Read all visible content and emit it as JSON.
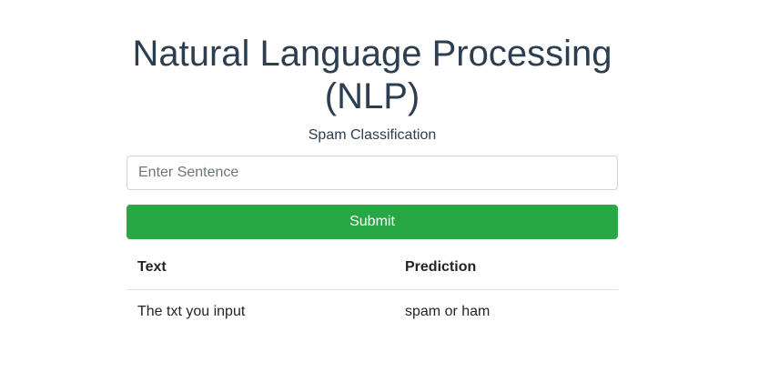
{
  "header": {
    "title": "Natural Language Processing (NLP)",
    "subtitle": "Spam Classification"
  },
  "form": {
    "input_placeholder": "Enter Sentence",
    "input_value": "",
    "submit_label": "Submit"
  },
  "results_table": {
    "columns": [
      "Text",
      "Prediction"
    ],
    "rows": [
      [
        "The txt you input",
        "spam or ham"
      ]
    ]
  },
  "colors": {
    "title": "#2c3e50",
    "submit_background": "#28a745",
    "submit_text": "#ffffff",
    "input_border": "#ced4da"
  }
}
